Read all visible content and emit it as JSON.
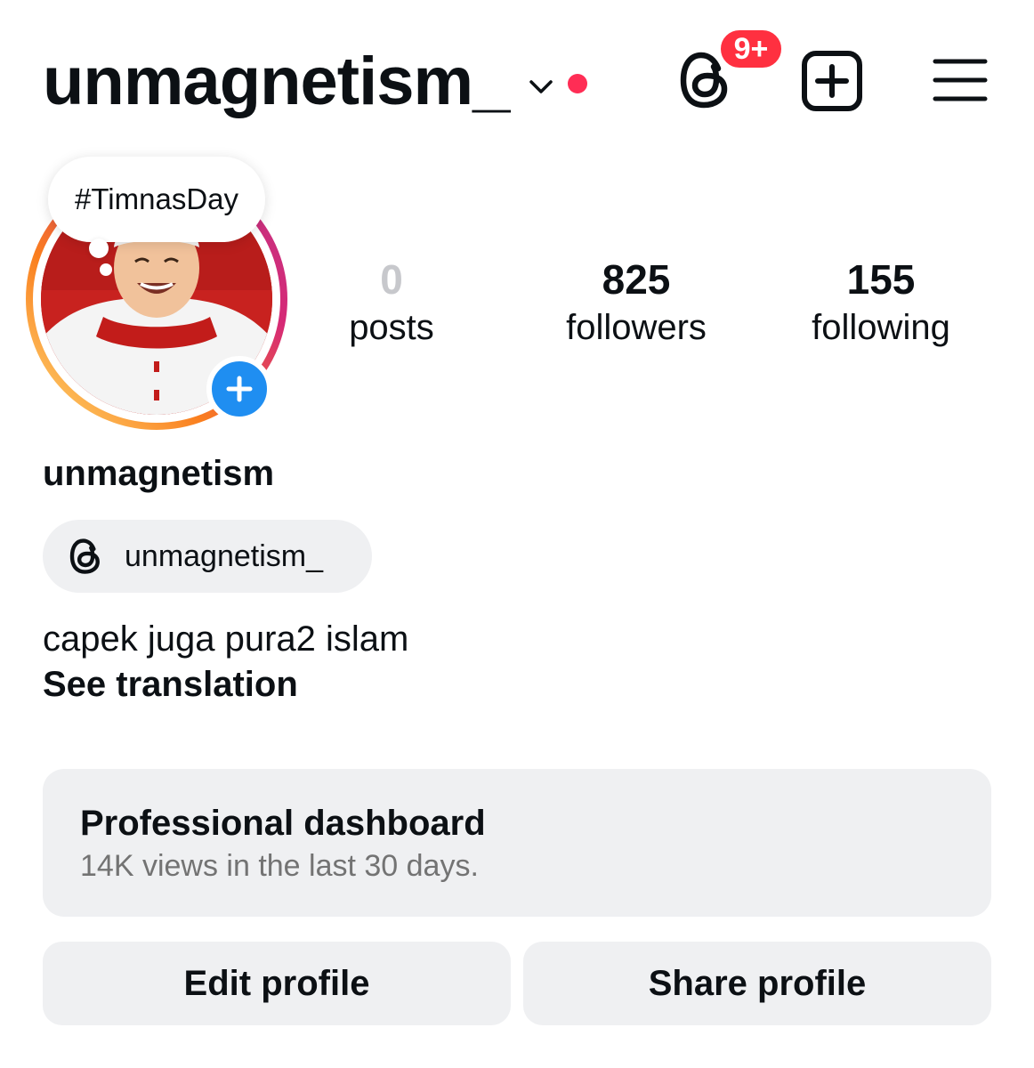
{
  "header": {
    "username": "unmagnetism_",
    "notification_badge": "9+",
    "icons": [
      "chevron-down-icon",
      "threads-icon",
      "add-post-icon",
      "menu-icon"
    ],
    "status_dot_color": "#ff2d55",
    "badge_color": "#ff3040"
  },
  "profile": {
    "note": "#TimnasDay",
    "display_name": "unmagnetism",
    "threads_handle": "unmagnetism_",
    "bio": "capek juga pura2 islam",
    "see_translation": "See translation",
    "story_ring_colors": [
      "#feda75",
      "#fa7e1e",
      "#d62976",
      "#962fbf"
    ]
  },
  "stats": {
    "posts": {
      "count": "0",
      "label": "posts"
    },
    "followers": {
      "count": "825",
      "label": "followers"
    },
    "following": {
      "count": "155",
      "label": "following"
    }
  },
  "dashboard": {
    "title": "Professional dashboard",
    "subtitle": "14K views in the last 30 days."
  },
  "actions": {
    "edit_profile": "Edit profile",
    "share_profile": "Share profile"
  }
}
